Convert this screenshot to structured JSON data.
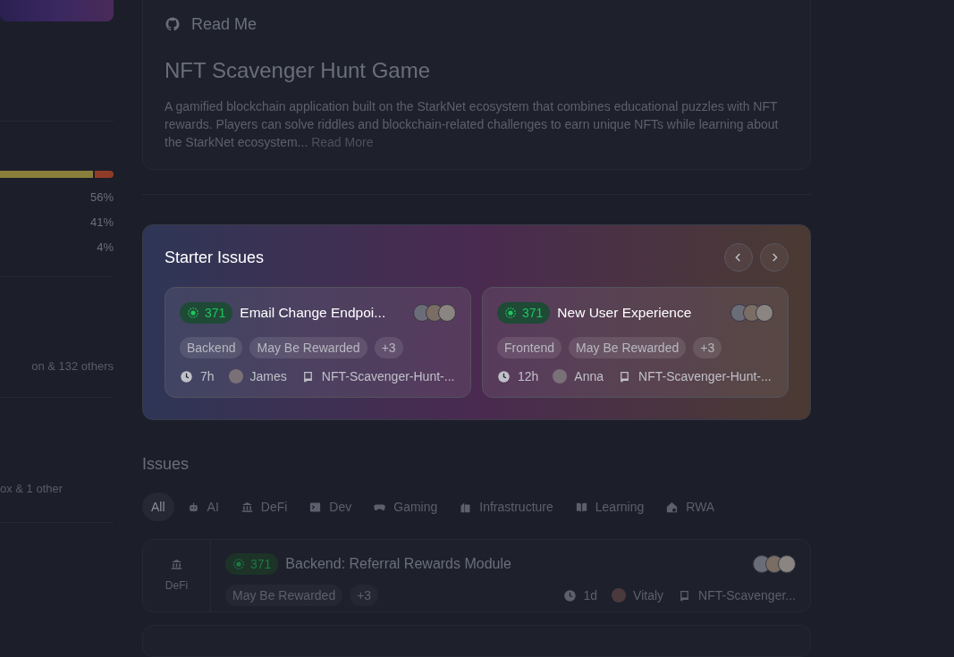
{
  "sidebar": {
    "language_bar": [
      {
        "level": 0.83,
        "color": "#8a7f3a"
      },
      {
        "level": 0.17,
        "color": "#8f3c26"
      }
    ],
    "language_percents": [
      "56%",
      "41%",
      "4%"
    ],
    "contributors_text": "on & 132 others",
    "maintainers_text": "ox & 1 other"
  },
  "readme": {
    "heading": "Read Me",
    "title": "NFT Scavenger Hunt Game",
    "description": "A gamified blockchain application built on the StarkNet ecosystem that combines educational puzzles with NFT rewards. Players can solve riddles and blockchain-related challenges to earn unique NFTs while learning about the StarkNet ecosystem...",
    "read_more": "Read More"
  },
  "starter_issues": {
    "title": "Starter Issues",
    "cards": [
      {
        "number": "371",
        "title": "Email Change Endpoi...",
        "tags": [
          "Backend",
          "May Be Rewarded",
          "+3"
        ],
        "time": "7h",
        "author": "James",
        "repo": "NFT-Scavenger-Hunt-..."
      },
      {
        "number": "371",
        "title": "New User Experience",
        "tags": [
          "Frontend",
          "May Be Rewarded",
          "+3"
        ],
        "time": "12h",
        "author": "Anna",
        "repo": "NFT-Scavenger-Hunt-..."
      }
    ]
  },
  "issues": {
    "title": "Issues",
    "filters": [
      {
        "label": "All",
        "kind": "none",
        "selected": true
      },
      {
        "label": "AI",
        "kind": "robot",
        "selected": false
      },
      {
        "label": "DeFi",
        "kind": "bank",
        "selected": false
      },
      {
        "label": "Dev",
        "kind": "terminal",
        "selected": false
      },
      {
        "label": "Gaming",
        "kind": "gamepad",
        "selected": false
      },
      {
        "label": "Infrastructure",
        "kind": "building",
        "selected": false
      },
      {
        "label": "Learning",
        "kind": "book",
        "selected": false
      },
      {
        "label": "RWA",
        "kind": "house",
        "selected": false
      }
    ],
    "rows": [
      {
        "category": "DeFi",
        "number": "371",
        "title": "Backend: Referral Rewards Module",
        "tags": [
          "May Be Rewarded",
          "+3"
        ],
        "time": "1d",
        "author": "Vitaly",
        "repo": "NFT-Scavenger..."
      }
    ]
  }
}
